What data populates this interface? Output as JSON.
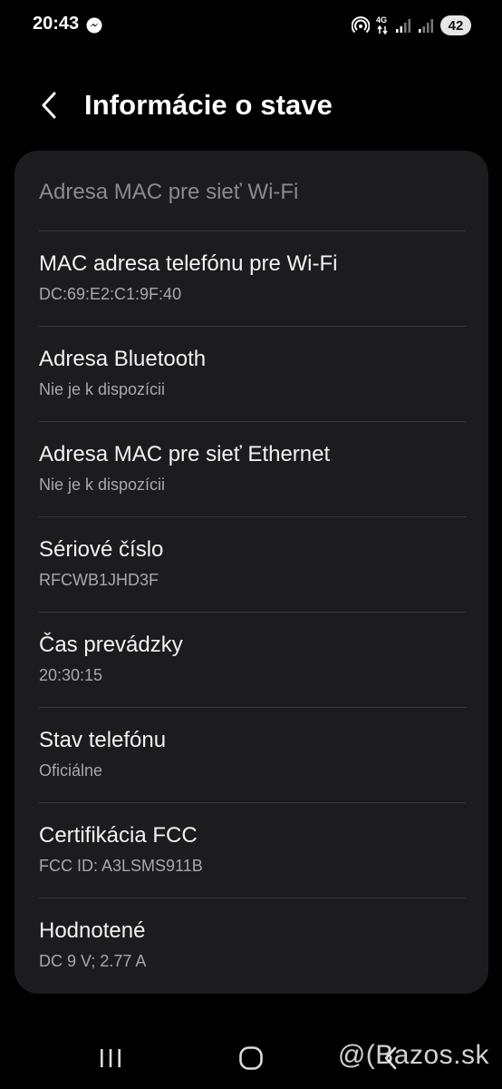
{
  "status_bar": {
    "time": "20:43",
    "network": "4G",
    "battery": "42"
  },
  "header": {
    "title": "Informácie o stave"
  },
  "section": {
    "header": "Adresa MAC pre sieť Wi-Fi"
  },
  "items": [
    {
      "title": "MAC adresa telefónu pre Wi-Fi",
      "value": "DC:69:E2:C1:9F:40"
    },
    {
      "title": "Adresa Bluetooth",
      "value": "Nie je k dispozícii"
    },
    {
      "title": "Adresa MAC pre sieť Ethernet",
      "value": "Nie je k dispozícii"
    },
    {
      "title": "Sériové číslo",
      "value": "RFCWB1JHD3F"
    },
    {
      "title": "Čas prevádzky",
      "value": "20:30:15"
    },
    {
      "title": "Stav telefónu",
      "value": "Oficiálne"
    },
    {
      "title": "Certifikácia FCC",
      "value": "FCC ID: A3LSMS911B"
    },
    {
      "title": "Hodnotené",
      "value": "DC 9 V; 2.77 A"
    }
  ],
  "watermark": "@(Bazos.sk",
  "colors": {
    "background": "#000000",
    "card": "#1c1c1e",
    "text_primary": "#f2f2f2",
    "text_secondary": "#a8a8ad"
  }
}
